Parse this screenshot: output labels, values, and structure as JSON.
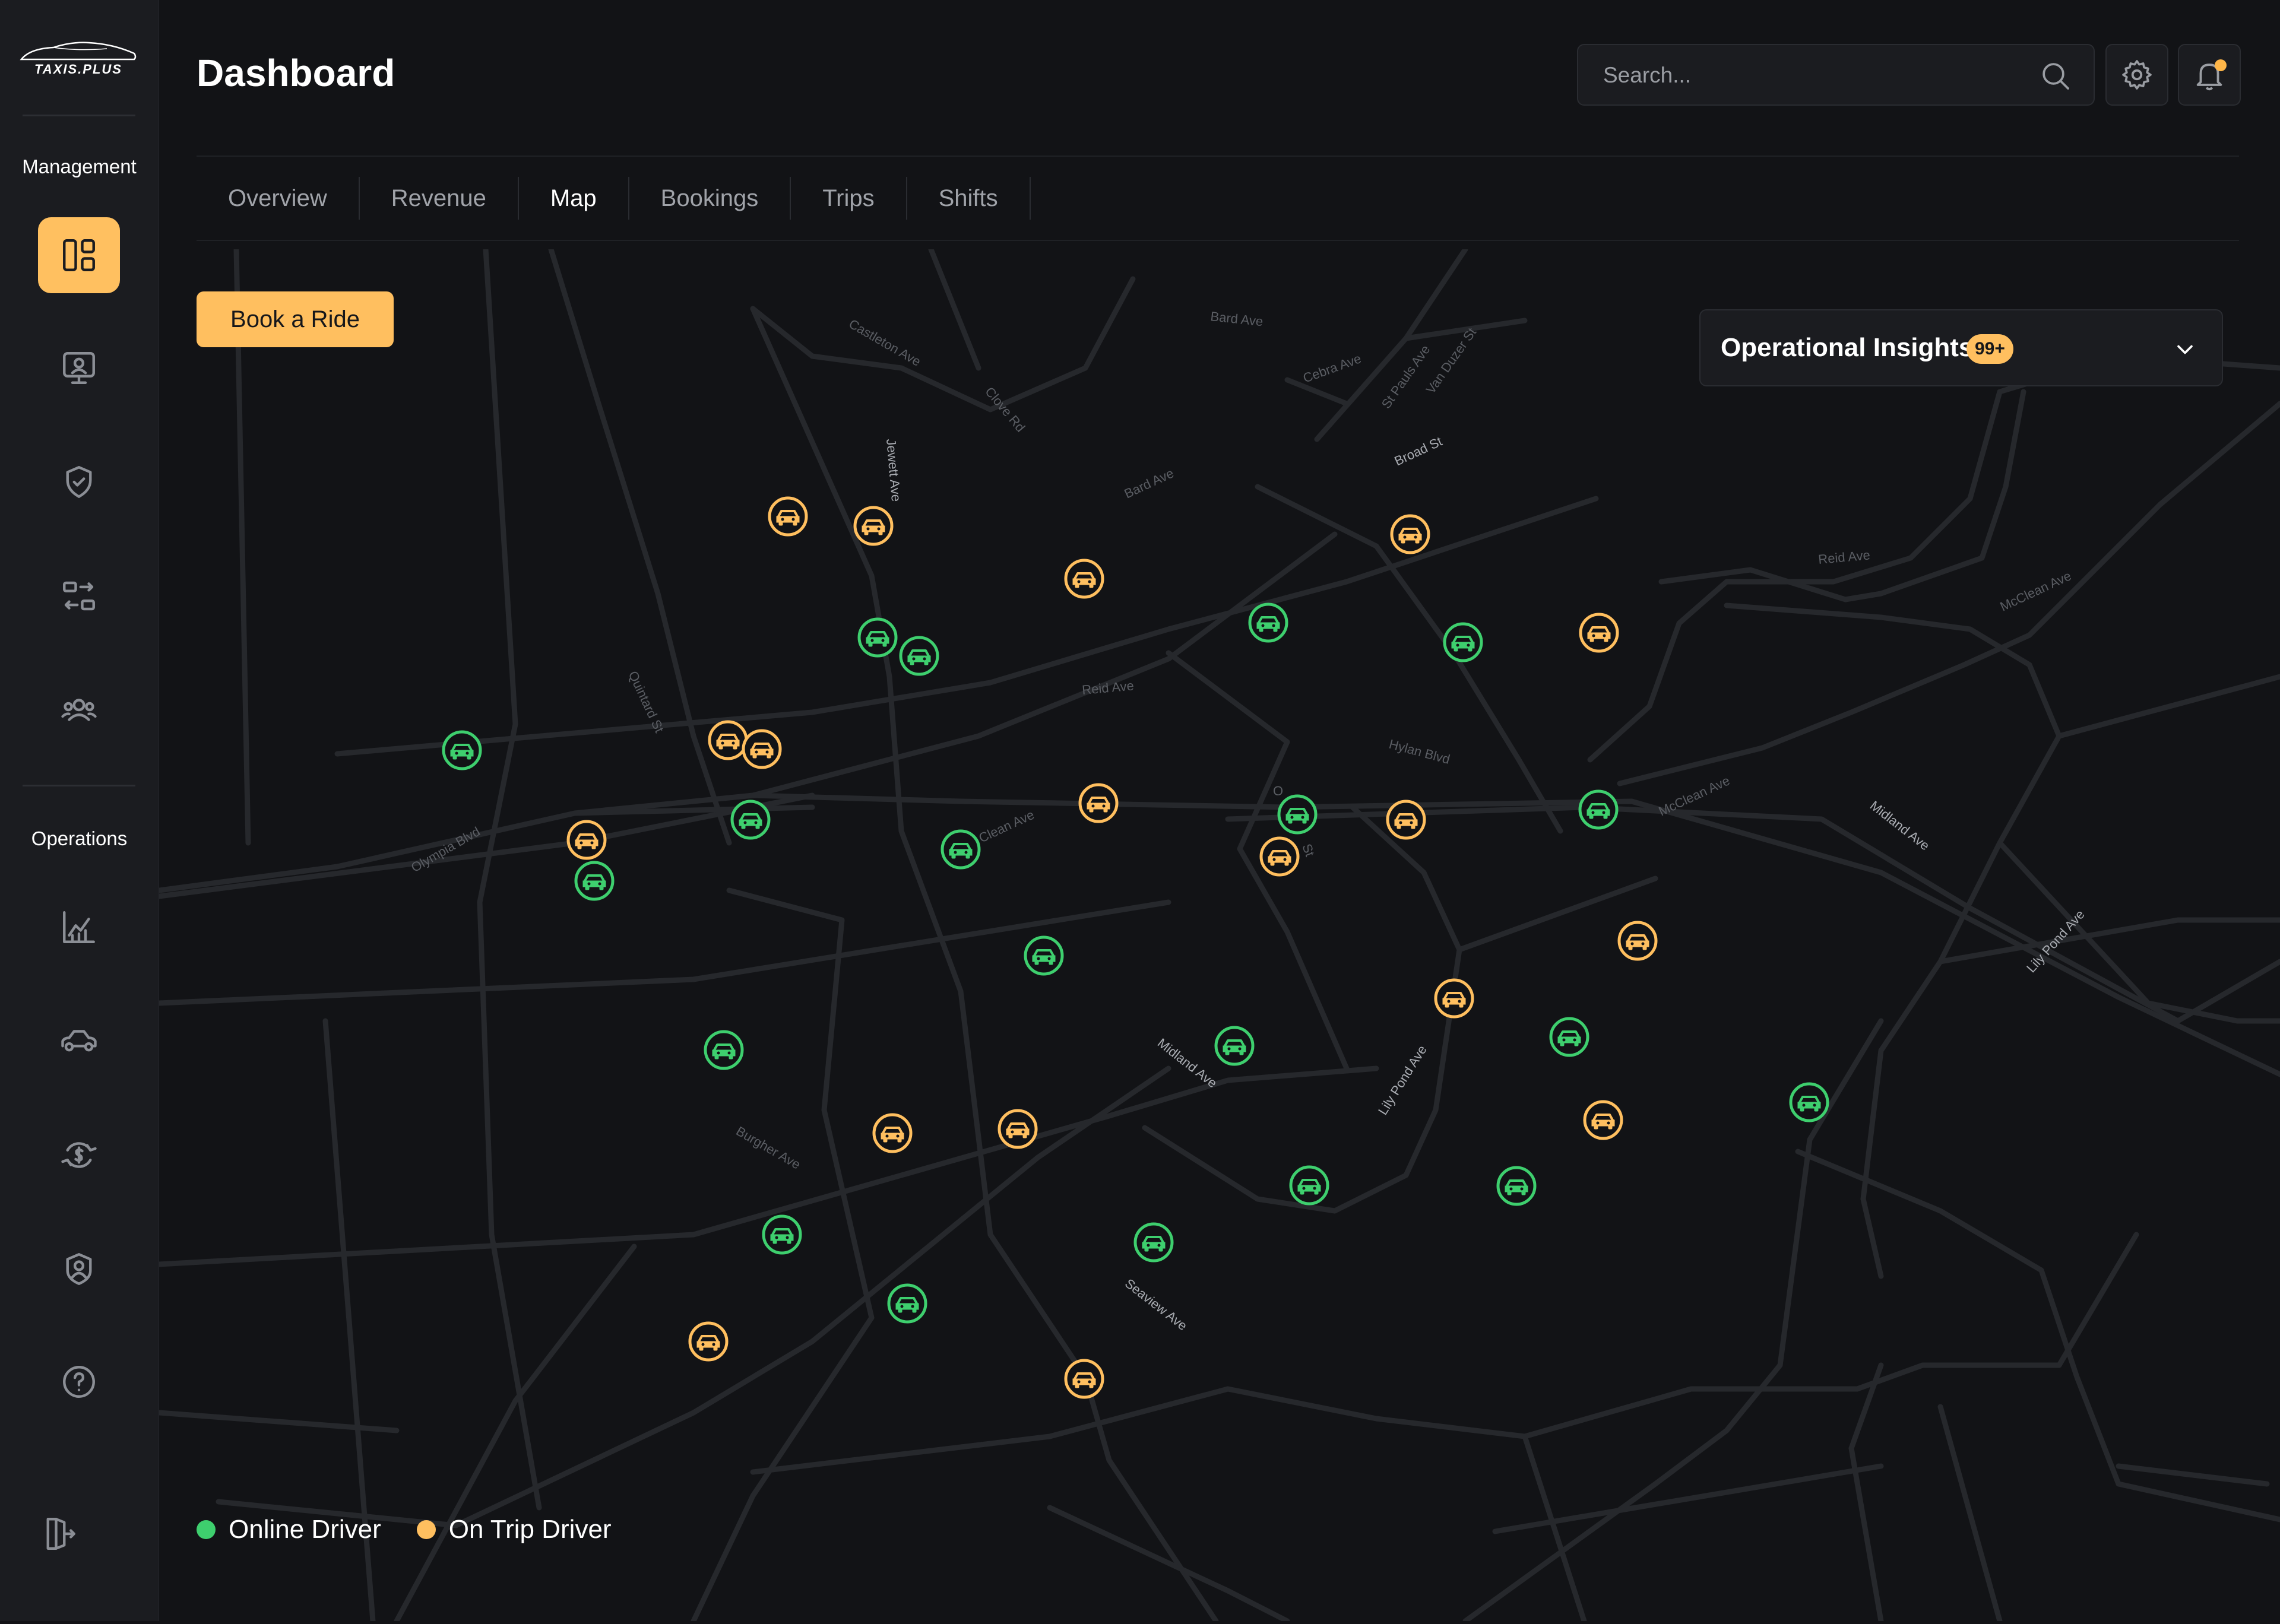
{
  "app": {
    "logo_text": "TAXIS.PLUS"
  },
  "sidebar": {
    "sections": [
      {
        "label": "Management",
        "items": [
          {
            "icon": "dashboard-icon",
            "active": true
          },
          {
            "icon": "monitor-user-icon",
            "active": false
          },
          {
            "icon": "shield-check-icon",
            "active": false
          },
          {
            "icon": "transfer-icon",
            "active": false
          },
          {
            "icon": "users-icon",
            "active": false
          }
        ]
      },
      {
        "label": "Operations",
        "items": [
          {
            "icon": "chart-icon",
            "active": false
          },
          {
            "icon": "car-icon",
            "active": false
          },
          {
            "icon": "dollar-cycle-icon",
            "active": false
          },
          {
            "icon": "user-circle-icon",
            "active": false
          },
          {
            "icon": "help-icon",
            "active": false
          }
        ]
      }
    ],
    "logout_icon": "logout-icon"
  },
  "header": {
    "title": "Dashboard",
    "search_placeholder": "Search...",
    "settings_icon": "gear-icon",
    "notification_icon": "bell-icon"
  },
  "tabs": [
    {
      "label": "Overview",
      "active": false
    },
    {
      "label": "Revenue",
      "active": false
    },
    {
      "label": "Map",
      "active": true
    },
    {
      "label": "Bookings",
      "active": false
    },
    {
      "label": "Trips",
      "active": false
    },
    {
      "label": "Shifts",
      "active": false
    }
  ],
  "actions": {
    "book_ride": "Book a Ride"
  },
  "insights": {
    "title": "Operational Insights",
    "badge": "99+"
  },
  "map": {
    "street_labels": {
      "castleton": "Castleton Ave",
      "clove": "Clove Rd",
      "jewett": "Jewett Ave",
      "bard1": "Bard Ave",
      "bard2": "Bard Ave",
      "cebra": "Cebra Ave",
      "stpauls": "St Pauls Ave",
      "vanduzer": "Van Duzer St",
      "broad": "Broad St",
      "reid1": "Reid Ave",
      "reid2": "Reid Ave",
      "mcclean1": "McClean Ave",
      "mcclean2": "McClean Ave",
      "mcclean3": "Clean Ave",
      "quintard": "Quintard St",
      "hylan": "Hylan Blvd",
      "olympia": "Olympia Blvd",
      "midland1": "Midland Ave",
      "midland2": "Midland Ave",
      "lilypond1": "Lily Pond Ave",
      "lilypond2": "Lily Pond Ave",
      "burgher": "Burgher Ave",
      "seaview": "Seaview Ave",
      "oq": "O",
      "st": "St"
    },
    "colors": {
      "online": "#3ecf6e",
      "on_trip": "#ffbf5f"
    }
  },
  "legend": {
    "online": "Online Driver",
    "on_trip": "On Trip Driver"
  }
}
